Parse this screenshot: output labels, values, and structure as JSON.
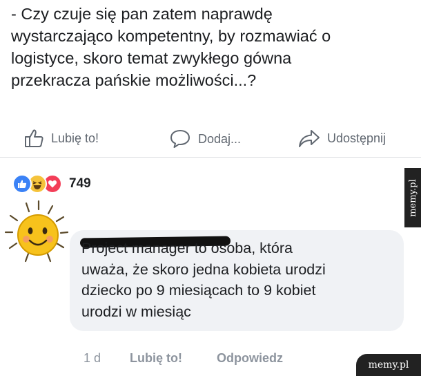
{
  "post": {
    "lines": [
      "- Czy czuje się pan zatem naprawdę",
      "wystarczająco kompetentny, by rozmawiać o",
      "logistyce, skoro temat zwykłego gówna",
      "przekracza pańskie możliwości...?"
    ]
  },
  "actions": {
    "like_label": "Lubię to!",
    "comment_label": "Dodaj...",
    "share_label": "Udostępnij",
    "like_icon": "thumbs-up-icon",
    "comment_icon": "speech-bubble-icon",
    "share_icon": "share-arrow-icon"
  },
  "reactions": {
    "types": [
      "like",
      "haha",
      "love"
    ],
    "count": "749",
    "colors": {
      "like": "#3b82f6",
      "haha": "#f5c33b",
      "love": "#f33e58"
    }
  },
  "comment": {
    "author_redacted": true,
    "lines": [
      "Project manager to osoba, która",
      "uważa, że skoro jedna kobieta urodzi",
      "dziecko po 9 miesiącach to 9 kobiet",
      "urodzi w miesiąc"
    ],
    "time": "1 d",
    "like_label": "Lubię to!",
    "reply_label": "Odpowiedz"
  },
  "watermark": {
    "side": "memy.pl",
    "bottom": "memy.pl"
  }
}
